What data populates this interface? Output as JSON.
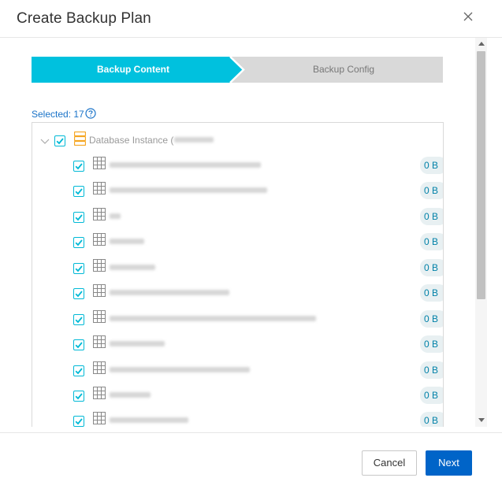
{
  "dialog": {
    "title": "Create Backup Plan"
  },
  "steps": [
    {
      "label": "Backup Content",
      "active": true
    },
    {
      "label": "Backup Config",
      "active": false
    }
  ],
  "selection": {
    "text": "Selected: 17"
  },
  "tree": {
    "root_label": "Database Instance (",
    "rows": [
      {
        "size": "0 B",
        "checked": true
      },
      {
        "size": "0 B",
        "checked": true
      },
      {
        "size": "0 B",
        "checked": true
      },
      {
        "size": "0 B",
        "checked": true
      },
      {
        "size": "0 B",
        "checked": true
      },
      {
        "size": "0 B",
        "checked": true
      },
      {
        "size": "0 B",
        "checked": true
      },
      {
        "size": "0 B",
        "checked": true
      },
      {
        "size": "0 B",
        "checked": true
      },
      {
        "size": "0 B",
        "checked": true
      },
      {
        "size": "0 B",
        "checked": true
      }
    ]
  },
  "footer": {
    "cancel_label": "Cancel",
    "next_label": "Next"
  },
  "colors": {
    "accent": "#00b9d6",
    "primary_button": "#0064c8",
    "step_inactive": "#d9d9d9",
    "link": "#1a73c8",
    "badge_bg": "#e8f0f2",
    "badge_text": "#0081a8",
    "db_icon": "#f5a623"
  },
  "icons": {
    "close": "close-icon",
    "help": "question-circle-icon",
    "expand": "chevron-down-icon",
    "database": "database-icon",
    "table": "table-icon",
    "checkbox": "checkbox-checked-icon"
  }
}
